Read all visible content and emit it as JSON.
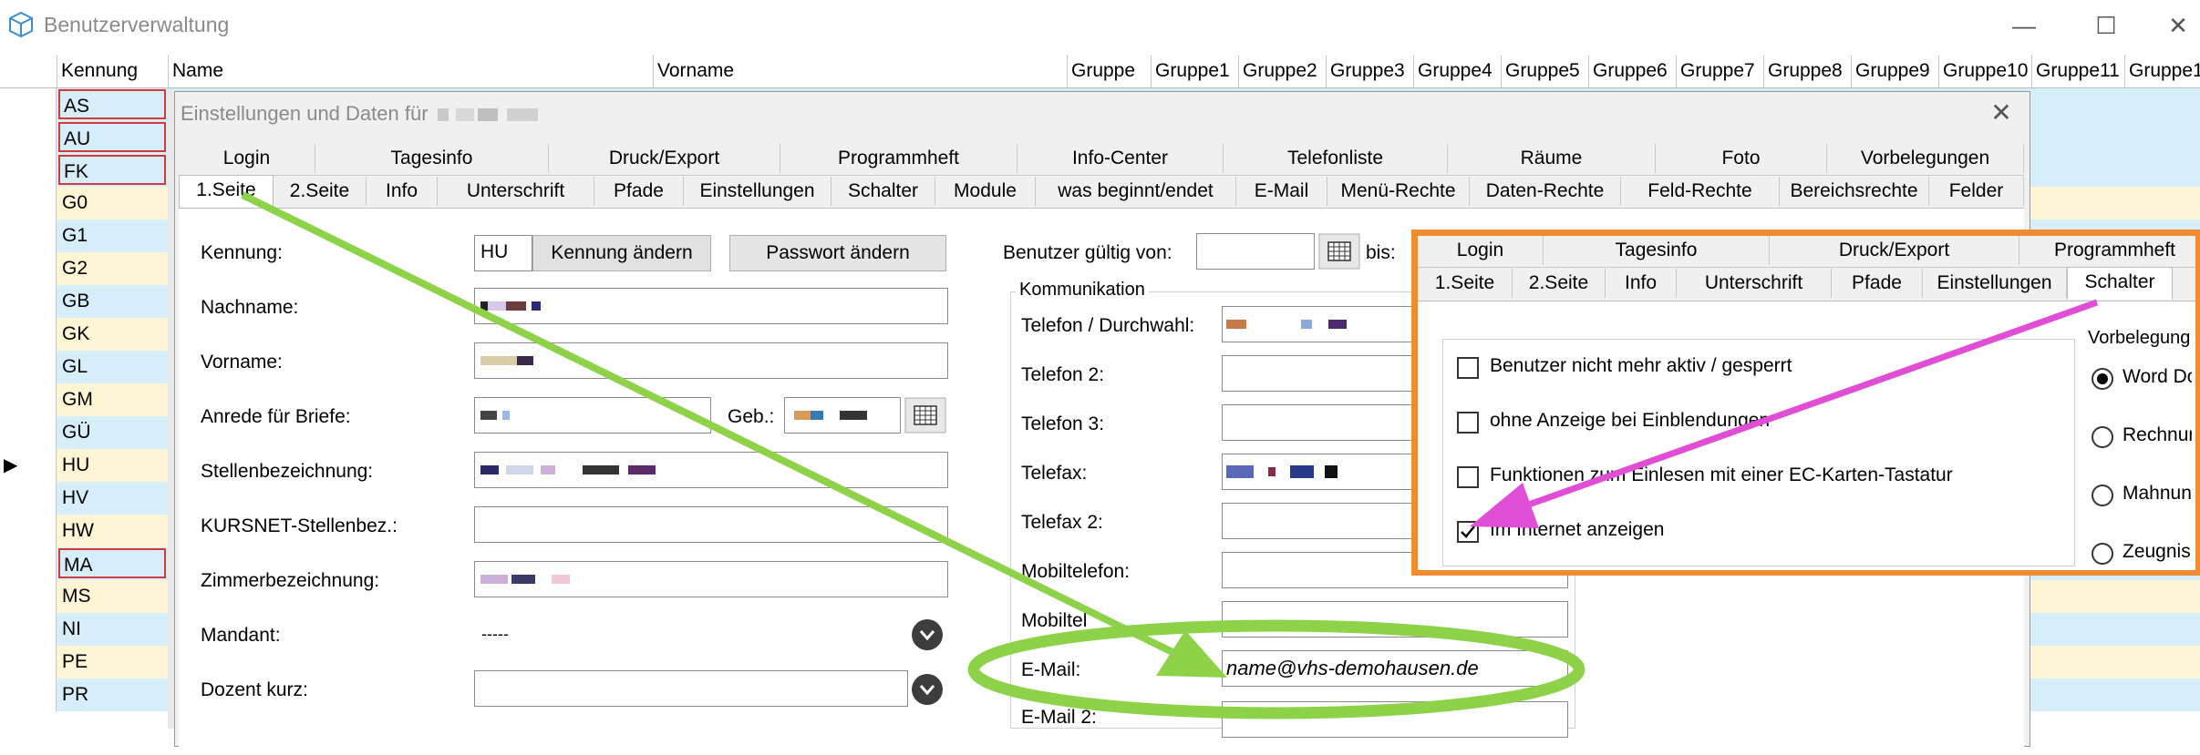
{
  "window": {
    "title": "Benutzerverwaltung",
    "minimize_glyph": "—",
    "maximize_glyph": "☐",
    "close_glyph": "✕"
  },
  "grid": {
    "headers": [
      "Kennung",
      "Name",
      "Vorname",
      "Gruppe",
      "Gruppe1",
      "Gruppe2",
      "Gruppe3",
      "Gruppe4",
      "Gruppe5",
      "Gruppe6",
      "Gruppe7",
      "Gruppe8",
      "Gruppe9",
      "Gruppe10",
      "Gruppe11",
      "Gruppe1"
    ],
    "rows": [
      {
        "code": "AS",
        "boxed": true
      },
      {
        "code": "AU",
        "boxed": true
      },
      {
        "code": "FK",
        "boxed": true
      },
      {
        "code": "G0",
        "boxed": false
      },
      {
        "code": "G1",
        "boxed": false
      },
      {
        "code": "G2",
        "boxed": false
      },
      {
        "code": "GB",
        "boxed": false
      },
      {
        "code": "GK",
        "boxed": false
      },
      {
        "code": "GL",
        "boxed": false
      },
      {
        "code": "GM",
        "boxed": false
      },
      {
        "code": "GÜ",
        "boxed": false
      },
      {
        "code": "HU",
        "boxed": false,
        "current": true
      },
      {
        "code": "HV",
        "boxed": false
      },
      {
        "code": "HW",
        "boxed": false
      },
      {
        "code": "MA",
        "boxed": true
      },
      {
        "code": "MS",
        "boxed": false
      },
      {
        "code": "NI",
        "boxed": false
      },
      {
        "code": "PE",
        "boxed": false
      },
      {
        "code": "PR",
        "boxed": false
      }
    ],
    "row_indicator": "▶"
  },
  "dialog": {
    "title": "Einstellungen und Daten für",
    "close_glyph": "✕",
    "tabs_row1": [
      "Login",
      "Tagesinfo",
      "Druck/Export",
      "Programmheft",
      "Info-Center",
      "Telefonliste",
      "Räume",
      "Foto",
      "Vorbelegungen"
    ],
    "tabs_row2": [
      "1.Seite",
      "2.Seite",
      "Info",
      "Unterschrift",
      "Pfade",
      "Einstellungen",
      "Schalter",
      "Module",
      "was beginnt/endet",
      "E-Mail",
      "Menü-Rechte",
      "Daten-Rechte",
      "Feld-Rechte",
      "Bereichsrechte",
      "Felder"
    ],
    "active_tab": "1.Seite",
    "form": {
      "kennung_label": "Kennung:",
      "kennung_value": "HU",
      "kennung_change_button": "Kennung ändern",
      "password_change_button": "Passwort ändern",
      "nachname_label": "Nachname:",
      "vorname_label": "Vorname:",
      "anrede_label": "Anrede für Briefe:",
      "geb_label": "Geb.:",
      "stellen_label": "Stellenbezeichnung:",
      "kursnet_label": "KURSNET-Stellenbez.:",
      "zimmer_label": "Zimmerbezeichnung:",
      "mandant_label": "Mandant:",
      "mandant_value": "-----",
      "dozent_label": "Dozent kurz:",
      "gueltig_label": "Benutzer gültig von:",
      "bis_label": "bis:"
    },
    "kommunikation": {
      "title": "Kommunikation",
      "telefon_label": "Telefon / Durchwahl:",
      "telefon2_label": "Telefon 2:",
      "telefon3_label": "Telefon 3:",
      "telefax_label": "Telefax:",
      "telefax2_label": "Telefax 2:",
      "mobil_label": "Mobiltelefon:",
      "mobil2_label": "Mobiltel",
      "email_label": "E-Mail:",
      "email_value": "name@vhs-demohausen.de",
      "email2_label": "E-Mail 2:"
    }
  },
  "overlay": {
    "tabs_row1": [
      "Login",
      "Tagesinfo",
      "Druck/Export",
      "Programmheft"
    ],
    "tabs_row2": [
      "1.Seite",
      "2.Seite",
      "Info",
      "Unterschrift",
      "Pfade",
      "Einstellungen",
      "Schalter"
    ],
    "active_tab": "Schalter",
    "checkboxes": [
      {
        "label": "Benutzer nicht mehr aktiv / gesperrt",
        "checked": false
      },
      {
        "label": "ohne Anzeige bei Einblendungen",
        "checked": false
      },
      {
        "label": "Funktionen zum Einlesen mit einer EC-Karten-Tastatur",
        "checked": false
      },
      {
        "label": "Im Internet anzeigen",
        "checked": true
      }
    ],
    "vorbelegung_title": "Vorbelegung",
    "radios": [
      {
        "label": "Word Do",
        "selected": true
      },
      {
        "label": "Rechnun",
        "selected": false
      },
      {
        "label": "Mahnun",
        "selected": false
      },
      {
        "label": "Zeugnis.",
        "selected": false
      }
    ]
  },
  "colors": {
    "annotation_green": "#8ed24a",
    "annotation_magenta": "#e04ed6",
    "annotation_orange": "#ef8c31",
    "row_blue": "#d6eefa",
    "row_yellow": "#fdf5d3",
    "row_box_red": "#d23a3a"
  },
  "icons": [
    "app-cube-icon",
    "calendar-icon",
    "dropdown-chevron-icon",
    "row-pointer-icon",
    "checkmark-icon"
  ]
}
